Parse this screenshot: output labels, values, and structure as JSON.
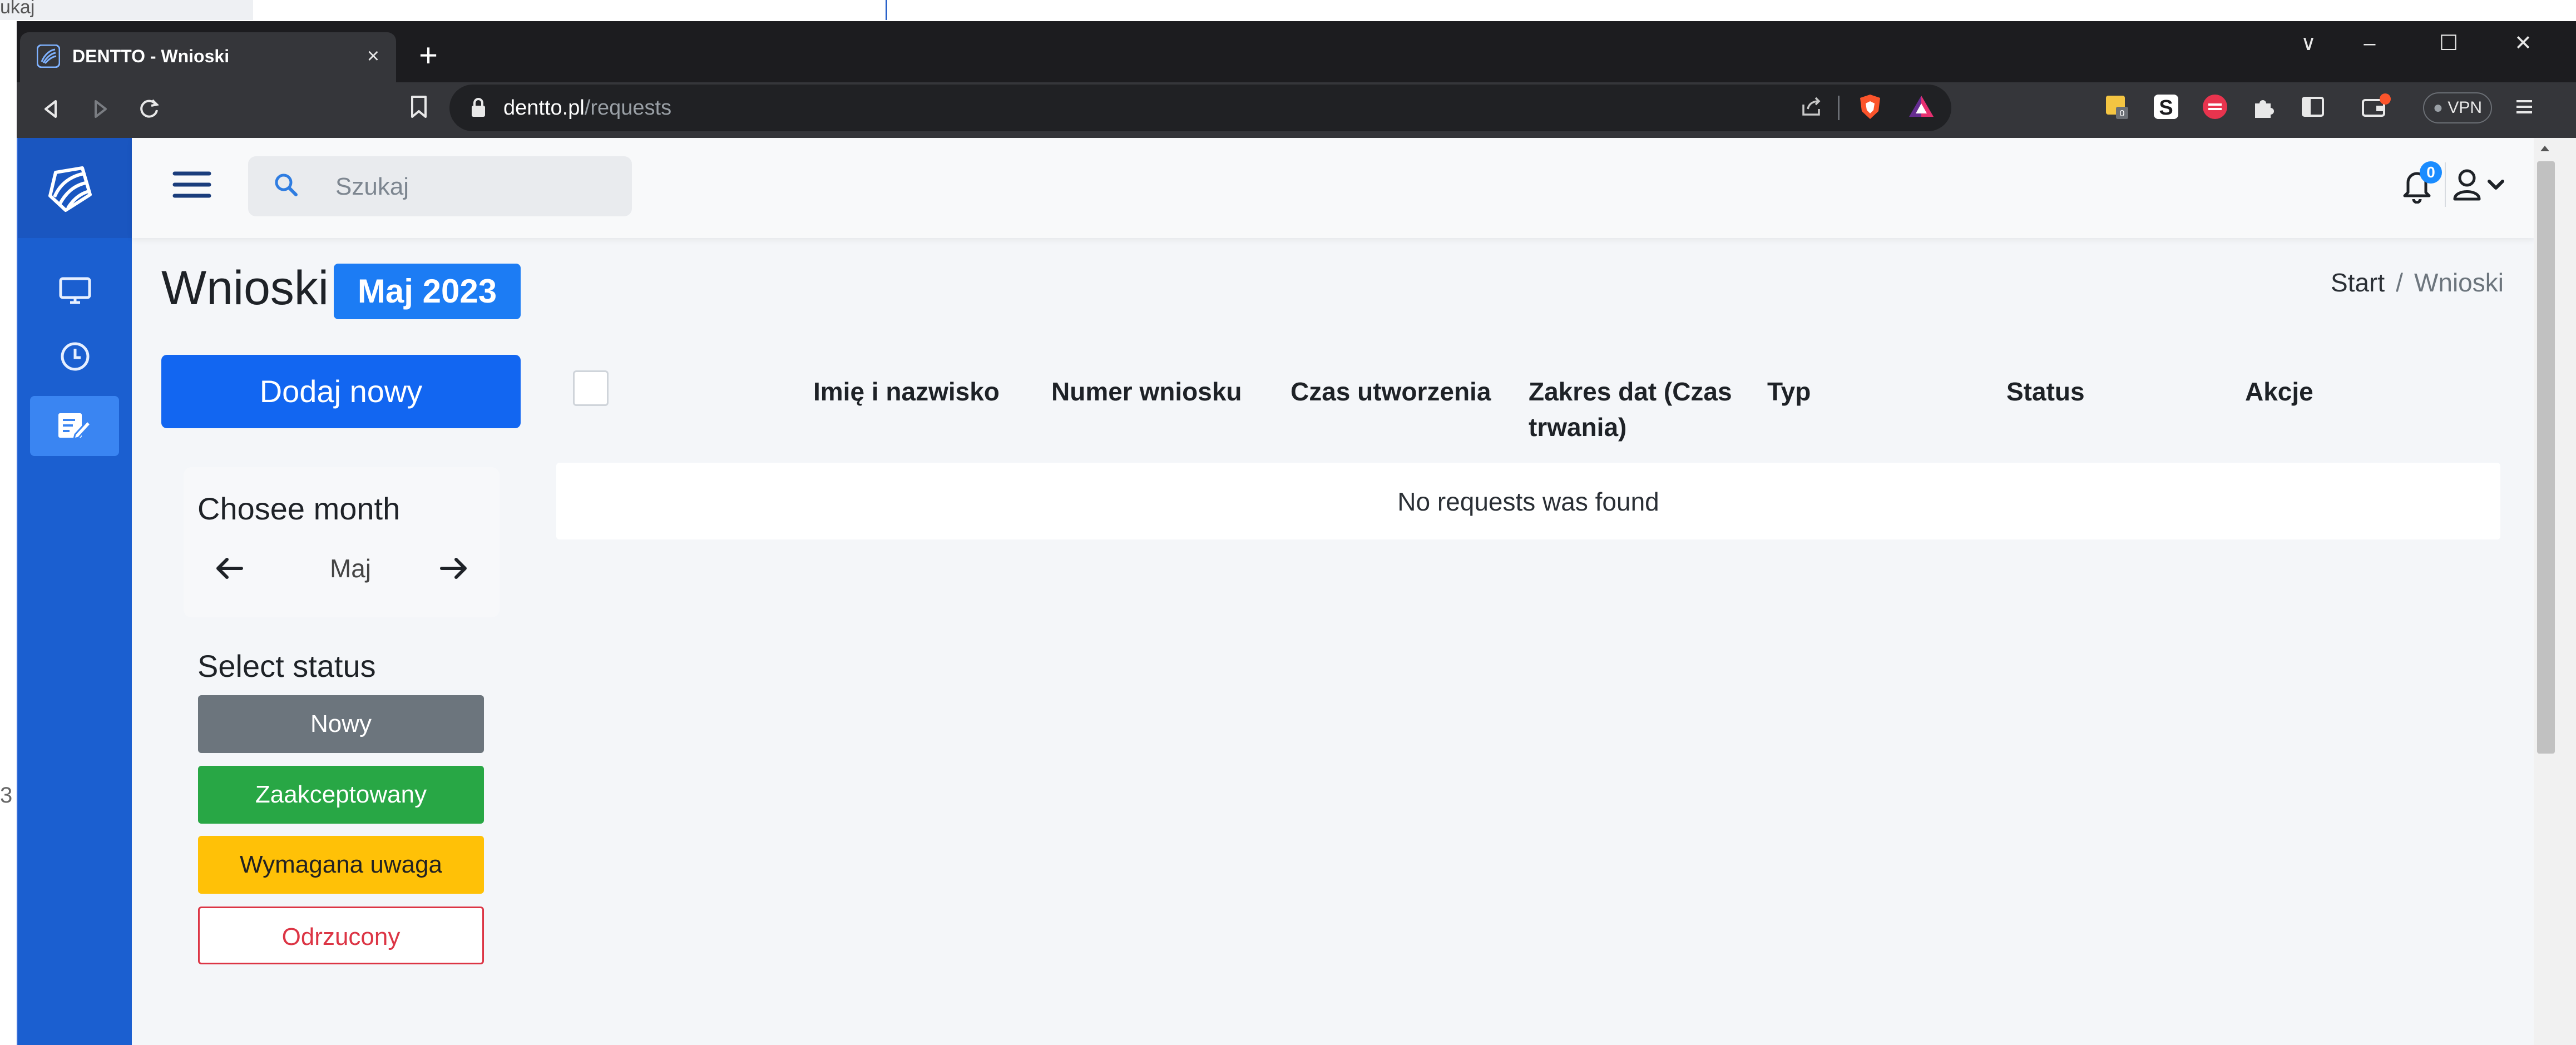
{
  "background_window": {
    "search_fragment": "ukaj",
    "side_fragment": "3"
  },
  "browser": {
    "tab_title": "DENTTO - Wnioski",
    "tab_close": "×",
    "new_tab": "+",
    "url_domain": "dentto.pl",
    "url_path": "/requests",
    "vpn_label": "VPN",
    "window_controls": [
      "∨",
      "–",
      "☐",
      "✕"
    ],
    "icons": [
      "back-icon",
      "forward-icon",
      "reload-icon",
      "bookmark-icon",
      "lock-icon",
      "share-icon",
      "brave-shield-icon",
      "brave-rewards-icon",
      "extension-icon",
      "puzzle-icon",
      "sidebar-icon",
      "wallet-icon",
      "menu-icon"
    ]
  },
  "app": {
    "search_placeholder": "Szukaj",
    "notifications_count": "0",
    "sidebar_items": [
      "monitor-icon",
      "clock-icon",
      "edit-document-icon"
    ],
    "active_sidebar_index": 2,
    "brand_color": "#1b5fd0"
  },
  "page": {
    "title": "Wnioski",
    "month_badge": "Maj 2023",
    "breadcrumb": {
      "home": "Start",
      "separator": "/",
      "current": "Wnioski"
    },
    "add_button": "Dodaj nowy",
    "month_picker": {
      "title": "Chosee month",
      "value": "Maj"
    },
    "status_filter": {
      "title": "Select status",
      "options": [
        {
          "label": "Nowy",
          "color": "#6c757d"
        },
        {
          "label": "Zaakceptowany",
          "color": "#28a745"
        },
        {
          "label": "Wymagana uwaga",
          "color": "#ffc107"
        },
        {
          "label": "Odrzucony",
          "color": "#dc3545"
        }
      ]
    },
    "table": {
      "columns": [
        "Imię i nazwisko",
        "Numer wniosku",
        "Czas utworzenia",
        "Zakres dat (Czas trwania)",
        "Typ",
        "Status",
        "Akcje"
      ],
      "empty_message": "No requests was found"
    }
  }
}
